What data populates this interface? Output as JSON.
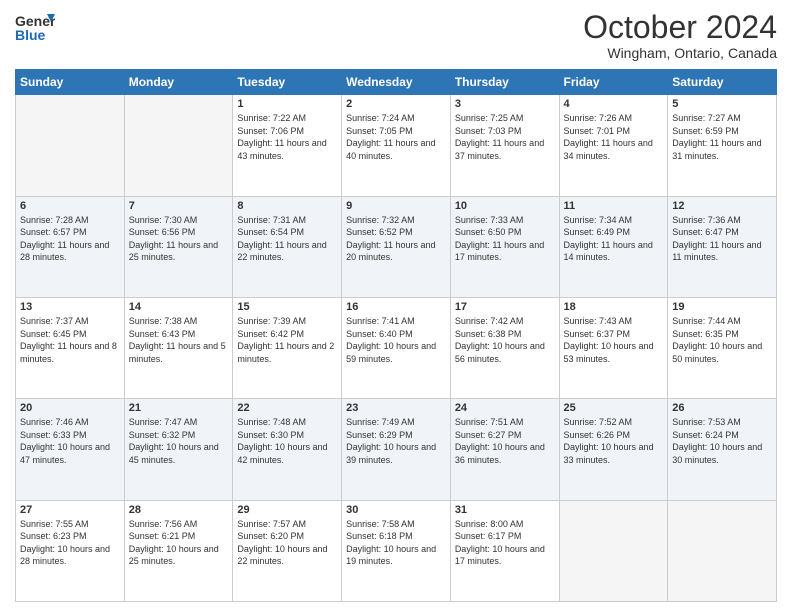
{
  "logo": {
    "line1": "General",
    "line2": "Blue"
  },
  "header": {
    "month": "October 2024",
    "location": "Wingham, Ontario, Canada"
  },
  "days_of_week": [
    "Sunday",
    "Monday",
    "Tuesday",
    "Wednesday",
    "Thursday",
    "Friday",
    "Saturday"
  ],
  "weeks": [
    [
      {
        "day": "",
        "info": ""
      },
      {
        "day": "",
        "info": ""
      },
      {
        "day": "1",
        "info": "Sunrise: 7:22 AM\nSunset: 7:06 PM\nDaylight: 11 hours and 43 minutes."
      },
      {
        "day": "2",
        "info": "Sunrise: 7:24 AM\nSunset: 7:05 PM\nDaylight: 11 hours and 40 minutes."
      },
      {
        "day": "3",
        "info": "Sunrise: 7:25 AM\nSunset: 7:03 PM\nDaylight: 11 hours and 37 minutes."
      },
      {
        "day": "4",
        "info": "Sunrise: 7:26 AM\nSunset: 7:01 PM\nDaylight: 11 hours and 34 minutes."
      },
      {
        "day": "5",
        "info": "Sunrise: 7:27 AM\nSunset: 6:59 PM\nDaylight: 11 hours and 31 minutes."
      }
    ],
    [
      {
        "day": "6",
        "info": "Sunrise: 7:28 AM\nSunset: 6:57 PM\nDaylight: 11 hours and 28 minutes."
      },
      {
        "day": "7",
        "info": "Sunrise: 7:30 AM\nSunset: 6:56 PM\nDaylight: 11 hours and 25 minutes."
      },
      {
        "day": "8",
        "info": "Sunrise: 7:31 AM\nSunset: 6:54 PM\nDaylight: 11 hours and 22 minutes."
      },
      {
        "day": "9",
        "info": "Sunrise: 7:32 AM\nSunset: 6:52 PM\nDaylight: 11 hours and 20 minutes."
      },
      {
        "day": "10",
        "info": "Sunrise: 7:33 AM\nSunset: 6:50 PM\nDaylight: 11 hours and 17 minutes."
      },
      {
        "day": "11",
        "info": "Sunrise: 7:34 AM\nSunset: 6:49 PM\nDaylight: 11 hours and 14 minutes."
      },
      {
        "day": "12",
        "info": "Sunrise: 7:36 AM\nSunset: 6:47 PM\nDaylight: 11 hours and 11 minutes."
      }
    ],
    [
      {
        "day": "13",
        "info": "Sunrise: 7:37 AM\nSunset: 6:45 PM\nDaylight: 11 hours and 8 minutes."
      },
      {
        "day": "14",
        "info": "Sunrise: 7:38 AM\nSunset: 6:43 PM\nDaylight: 11 hours and 5 minutes."
      },
      {
        "day": "15",
        "info": "Sunrise: 7:39 AM\nSunset: 6:42 PM\nDaylight: 11 hours and 2 minutes."
      },
      {
        "day": "16",
        "info": "Sunrise: 7:41 AM\nSunset: 6:40 PM\nDaylight: 10 hours and 59 minutes."
      },
      {
        "day": "17",
        "info": "Sunrise: 7:42 AM\nSunset: 6:38 PM\nDaylight: 10 hours and 56 minutes."
      },
      {
        "day": "18",
        "info": "Sunrise: 7:43 AM\nSunset: 6:37 PM\nDaylight: 10 hours and 53 minutes."
      },
      {
        "day": "19",
        "info": "Sunrise: 7:44 AM\nSunset: 6:35 PM\nDaylight: 10 hours and 50 minutes."
      }
    ],
    [
      {
        "day": "20",
        "info": "Sunrise: 7:46 AM\nSunset: 6:33 PM\nDaylight: 10 hours and 47 minutes."
      },
      {
        "day": "21",
        "info": "Sunrise: 7:47 AM\nSunset: 6:32 PM\nDaylight: 10 hours and 45 minutes."
      },
      {
        "day": "22",
        "info": "Sunrise: 7:48 AM\nSunset: 6:30 PM\nDaylight: 10 hours and 42 minutes."
      },
      {
        "day": "23",
        "info": "Sunrise: 7:49 AM\nSunset: 6:29 PM\nDaylight: 10 hours and 39 minutes."
      },
      {
        "day": "24",
        "info": "Sunrise: 7:51 AM\nSunset: 6:27 PM\nDaylight: 10 hours and 36 minutes."
      },
      {
        "day": "25",
        "info": "Sunrise: 7:52 AM\nSunset: 6:26 PM\nDaylight: 10 hours and 33 minutes."
      },
      {
        "day": "26",
        "info": "Sunrise: 7:53 AM\nSunset: 6:24 PM\nDaylight: 10 hours and 30 minutes."
      }
    ],
    [
      {
        "day": "27",
        "info": "Sunrise: 7:55 AM\nSunset: 6:23 PM\nDaylight: 10 hours and 28 minutes."
      },
      {
        "day": "28",
        "info": "Sunrise: 7:56 AM\nSunset: 6:21 PM\nDaylight: 10 hours and 25 minutes."
      },
      {
        "day": "29",
        "info": "Sunrise: 7:57 AM\nSunset: 6:20 PM\nDaylight: 10 hours and 22 minutes."
      },
      {
        "day": "30",
        "info": "Sunrise: 7:58 AM\nSunset: 6:18 PM\nDaylight: 10 hours and 19 minutes."
      },
      {
        "day": "31",
        "info": "Sunrise: 8:00 AM\nSunset: 6:17 PM\nDaylight: 10 hours and 17 minutes."
      },
      {
        "day": "",
        "info": ""
      },
      {
        "day": "",
        "info": ""
      }
    ]
  ]
}
